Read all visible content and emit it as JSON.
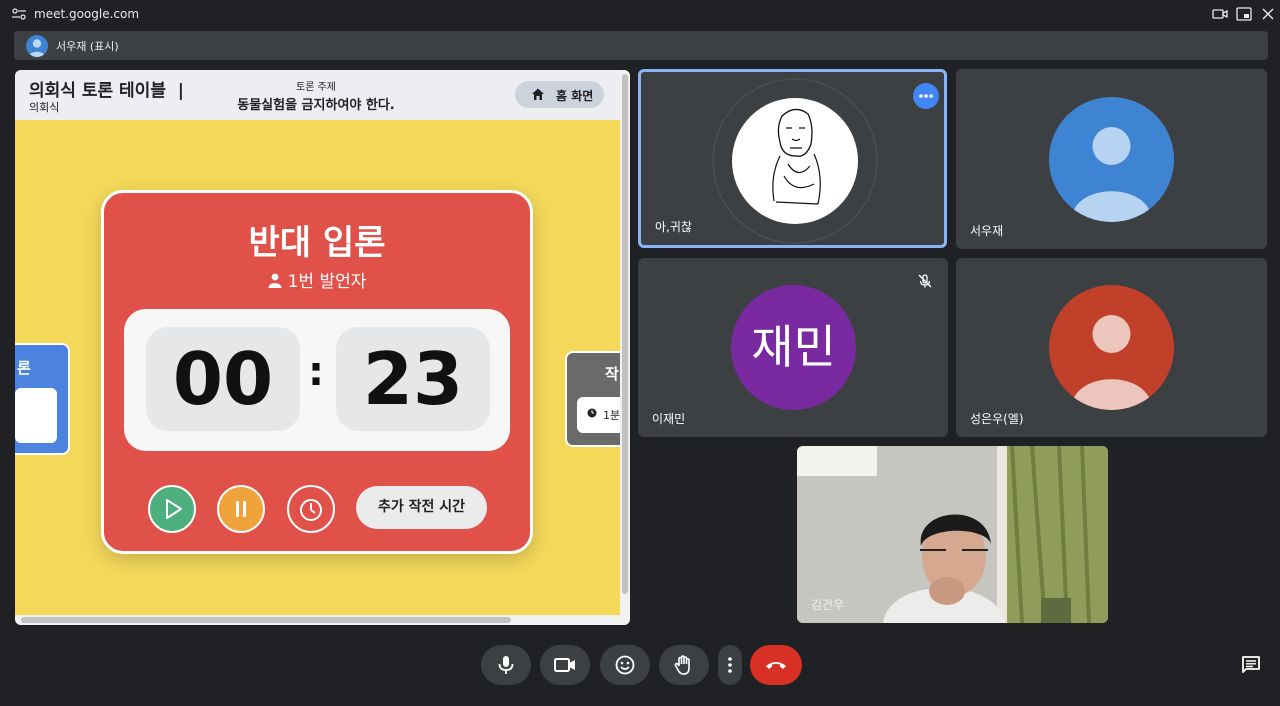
{
  "browser": {
    "url": "meet.google.com"
  },
  "presenting_bar": {
    "label": "서우재 (표시)"
  },
  "shared_screen": {
    "app_title": "의회식 토론 테이블",
    "app_subtitle": "의회식",
    "topic_label": "토론 주제",
    "topic_text": "동물실험을 금지하여야 한다.",
    "home_button": "홈 화면",
    "left_card_label": "론",
    "right_card_label": "작",
    "right_card_time": "1분",
    "main_card": {
      "title": "반대 입론",
      "speaker": "1번 발언자",
      "minutes": "00",
      "separator": ":",
      "seconds": "23",
      "extra_time_button": "추가 작전 시간"
    },
    "colors": {
      "background": "#f3d85a",
      "main_card": "#e0514a",
      "play_button": "#4caf7d",
      "pause_button": "#f0a33a"
    }
  },
  "participants": [
    {
      "name": "아,귀찮",
      "avatar": "sketch-drawing",
      "pinned_border": "#8ab4f8"
    },
    {
      "name": "서우재",
      "avatar": "default-person-icon",
      "color": "#3f84d2"
    },
    {
      "name": "이재민",
      "avatar_text": "재민",
      "color": "#7a2aa0",
      "muted": true
    },
    {
      "name": "성은우(엘)",
      "avatar": "default-person-icon",
      "color": "#c1402a"
    },
    {
      "name": "김건우",
      "avatar": "camera-video"
    }
  ],
  "controls": [
    {
      "name": "microphone",
      "icon": "mic-icon"
    },
    {
      "name": "camera",
      "icon": "videocam-icon"
    },
    {
      "name": "emoji",
      "icon": "emoji-icon"
    },
    {
      "name": "raise-hand",
      "icon": "hand-icon"
    },
    {
      "name": "more",
      "icon": "more-vert-icon"
    },
    {
      "name": "leave-call",
      "icon": "call-end-icon",
      "color": "#d93025"
    },
    {
      "name": "chat",
      "icon": "chat-icon"
    }
  ]
}
